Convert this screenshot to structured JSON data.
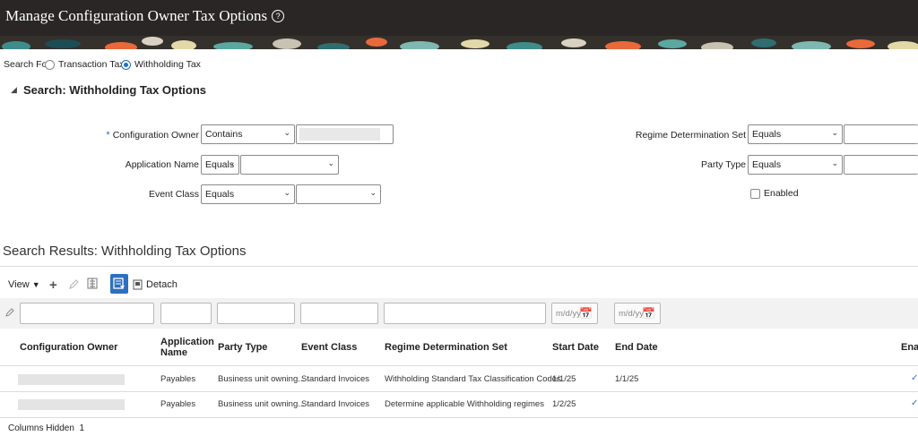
{
  "header": {
    "title": "Manage Configuration Owner Tax Options"
  },
  "search_for": {
    "label": "Search For",
    "options": [
      {
        "label": "Transaction Tax",
        "selected": false
      },
      {
        "label": "Withholding Tax",
        "selected": true
      }
    ]
  },
  "search": {
    "title": "Search: Withholding Tax Options",
    "config_owner": {
      "required_mark": "*",
      "label": "Configuration Owner",
      "operator": "Contains",
      "value": ""
    },
    "application_name": {
      "label": "Application Name",
      "operator": "Equals",
      "value": ""
    },
    "event_class": {
      "label": "Event Class",
      "operator": "Equals",
      "value": ""
    },
    "regime_determination_set": {
      "label": "Regime Determination Set",
      "operator": "Equals",
      "value": ""
    },
    "party_type": {
      "label": "Party Type",
      "operator": "Equals",
      "value": ""
    },
    "enabled": {
      "label": "Enabled",
      "checked": false
    }
  },
  "results": {
    "title": "Search Results: Withholding Tax Options",
    "toolbar": {
      "view_label": "View",
      "detach_label": "Detach"
    },
    "date_placeholder": "m/d/yy",
    "columns": [
      "Configuration Owner",
      "Application Name",
      "Party Type",
      "Event Class",
      "Regime Determination Set",
      "Start Date",
      "End Date",
      "Enal"
    ],
    "rows": [
      {
        "owner": "",
        "application": "Payables",
        "party_type": "Business unit owning...",
        "event_class": "Standard Invoices",
        "regime_set": "Withholding Standard Tax Classification Codes",
        "start_date": "1/1/25",
        "end_date": "1/1/25"
      },
      {
        "owner": "",
        "application": "Payables",
        "party_type": "Business unit owning...",
        "event_class": "Standard Invoices",
        "regime_set": "Determine applicable Withholding regimes",
        "start_date": "1/2/25",
        "end_date": ""
      }
    ],
    "columns_hidden_label": "Columns Hidden",
    "columns_hidden_count": "1"
  },
  "colors": {
    "header_bg": "#2a2626",
    "accent": "#1f6fc5"
  }
}
